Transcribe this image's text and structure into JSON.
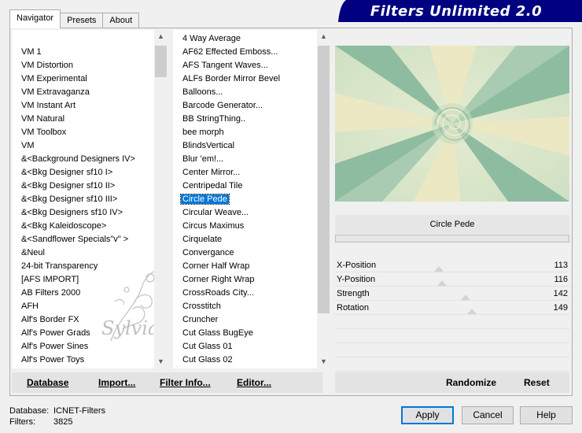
{
  "tabs": [
    "Navigator",
    "Presets",
    "About"
  ],
  "banner_title": "Filters Unlimited 2.0",
  "categories": [
    "VM 1",
    "VM Distortion",
    "VM Experimental",
    "VM Extravaganza",
    "VM Instant Art",
    "VM Natural",
    "VM Toolbox",
    "VM",
    "&<Background Designers IV>",
    "&<Bkg Designer sf10 I>",
    "&<Bkg Designer sf10 II>",
    "&<Bkg Designer sf10 III>",
    "&<Bkg Designers sf10 IV>",
    "&<Bkg Kaleidoscope>",
    "&<Sandflower Specials\"v\" >",
    "&Neul",
    "24-bit Transparency",
    "[AFS IMPORT]",
    "AB Filters 2000",
    "AFH",
    "Alf's Border FX",
    "Alf's Power Grads",
    "Alf's Power Sines",
    "Alf's Power Toys"
  ],
  "filters": [
    "4 Way Average",
    "AF62 Effected Emboss...",
    "AFS Tangent Waves...",
    "ALFs Border Mirror Bevel",
    "Balloons...",
    "Barcode Generator...",
    "BB StringThing..",
    "bee morph",
    "BlindsVertical",
    "Blur 'em!...",
    "Center Mirror...",
    "Centripedal Tile",
    "Circle Pede",
    "Circular Weave...",
    "Circus Maximus",
    "Cirquelate",
    "Convergance",
    "Corner Half Wrap",
    "Corner Right Wrap",
    "CrossRoads City...",
    "Crosstitch",
    "Cruncher",
    "Cut Glass  BugEye",
    "Cut Glass 01",
    "Cut Glass 02"
  ],
  "selected_filter": "Circle Pede",
  "params": [
    {
      "name": "X-Position",
      "value": "113",
      "level": 113
    },
    {
      "name": "Y-Position",
      "value": "116",
      "level": 116
    },
    {
      "name": "Strength",
      "value": "142",
      "level": 142
    },
    {
      "name": "Rotation",
      "value": "149",
      "level": 149
    }
  ],
  "buttons": {
    "database": "Database",
    "import": "Import...",
    "filter_info": "Filter Info...",
    "editor": "Editor...",
    "randomize": "Randomize",
    "reset": "Reset",
    "apply": "Apply",
    "cancel": "Cancel",
    "help": "Help"
  },
  "status": {
    "database_label": "Database:",
    "database_value": "ICNET-Filters",
    "filters_label": "Filters:",
    "filters_value": "3825"
  },
  "icons": {
    "scroll_up": "chevron-up-icon",
    "scroll_down": "chevron-down-icon"
  },
  "colors": {
    "banner": "#000080",
    "selection": "#0078d7",
    "preview_green": "#8ebca0",
    "preview_cream": "#ece8c4"
  }
}
